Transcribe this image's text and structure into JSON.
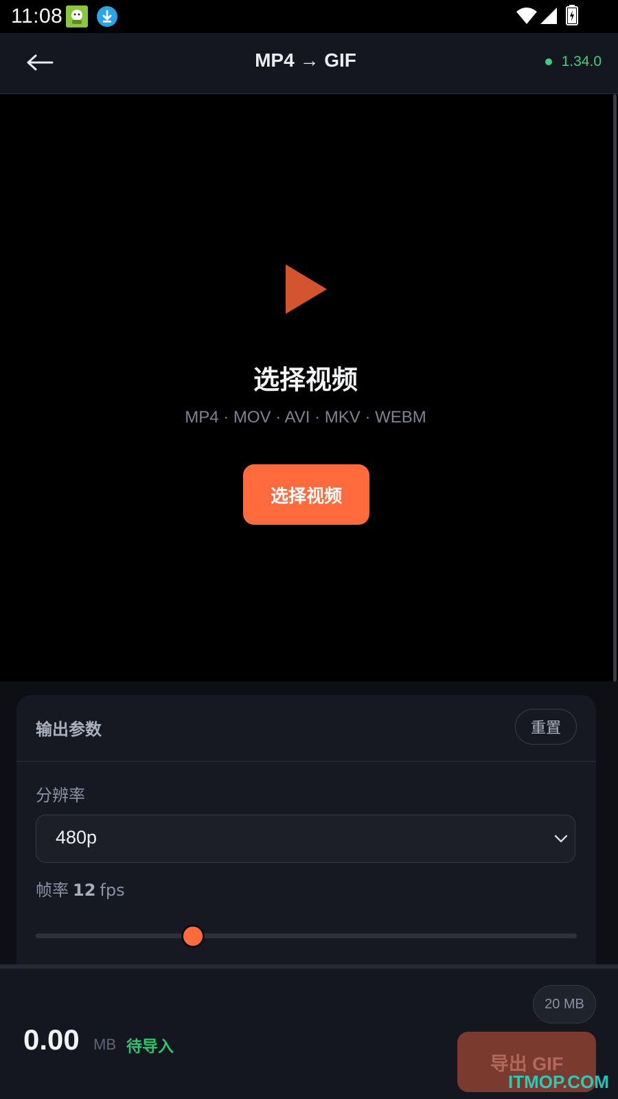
{
  "status_bar": {
    "time": "11:08",
    "icons": [
      "app-icon",
      "download-icon",
      "wifi-icon",
      "signal-icon",
      "battery-charging-icon"
    ]
  },
  "app_bar": {
    "back_icon": "arrow-left-icon",
    "title": "MP4 → GIF",
    "version": "1.34.0",
    "version_dot_color": "#3ecf7a"
  },
  "picker": {
    "icon": "play-icon",
    "title": "选择视频",
    "formats": "MP4 · MOV · AVI · MKV · WEBM",
    "button_label": "选择视频"
  },
  "settings": {
    "title": "输出参数",
    "reset_label": "重置",
    "resolution": {
      "label": "分辨率",
      "value": "480p"
    },
    "fps": {
      "label": "帧率",
      "value": "12",
      "unit": "fps",
      "slider_level": 0.29
    }
  },
  "bottom": {
    "size_limit": "20 MB",
    "size_value": "0.00",
    "size_unit": "MB",
    "status": "待导入",
    "export_label": "导出 GIF"
  },
  "watermark": "ITMOP.COM",
  "colors": {
    "accent": "#ff6b3d",
    "status_green": "#2fc46d",
    "background": "#14171f"
  }
}
